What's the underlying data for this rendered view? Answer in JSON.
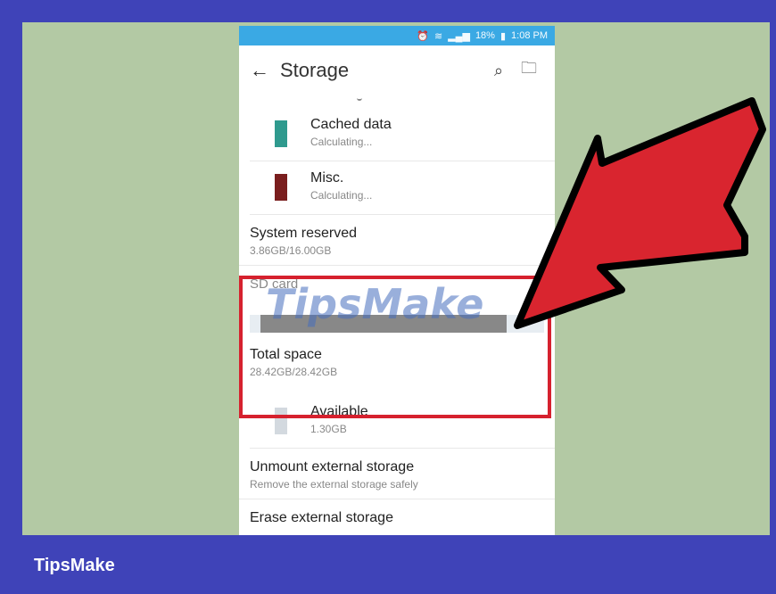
{
  "status_bar": {
    "icons": [
      "alarm-icon",
      "wifi-icon",
      "signal-icon",
      "battery-icon"
    ],
    "battery": "18%",
    "time": "1:08 PM"
  },
  "app_bar": {
    "title": "Storage",
    "back_icon": "arrow-left-icon",
    "actions": [
      "search-icon",
      "folder-icon"
    ]
  },
  "list": {
    "cached": {
      "title": "Cached data",
      "sub": "Calculating...",
      "color": "#2f9a8e"
    },
    "misc": {
      "title": "Misc.",
      "sub": "Calculating...",
      "color": "#7a1e1e"
    },
    "system": {
      "title": "System reserved",
      "sub": "3.86GB/16.00GB"
    },
    "sd_card": {
      "label": "SD card"
    },
    "total": {
      "title": "Total space",
      "sub": "28.42GB/28.42GB"
    },
    "available": {
      "title": "Available",
      "sub": "1.30GB",
      "color": "#d3d9df"
    },
    "unmount": {
      "title": "Unmount external storage",
      "sub": "Remove the external storage safely"
    },
    "erase": {
      "title": "Erase external storage"
    }
  },
  "overlay": {
    "watermark": "TipsMake",
    "highlight_color": "#d6212e",
    "arrow_color": "#d9252f"
  },
  "footer": {
    "brand": "TipsMake"
  }
}
